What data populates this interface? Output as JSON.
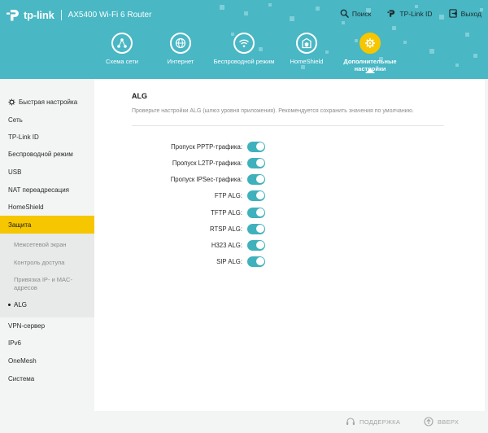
{
  "brand": {
    "logo_text": "tp-link",
    "model": "AX5400 Wi-Fi 6 Router"
  },
  "topbar": {
    "search": "Поиск",
    "tplink_id": "TP-Link ID",
    "exit": "Выход"
  },
  "nav_tabs": [
    {
      "label": "Схема сети",
      "icon": "network-map-icon"
    },
    {
      "label": "Интернет",
      "icon": "globe-icon"
    },
    {
      "label": "Беспроводной режим",
      "icon": "wifi-icon"
    },
    {
      "label": "HomeShield",
      "icon": "homeshield-icon"
    },
    {
      "label": "Дополнительные настройки",
      "icon": "advanced-gear-icon",
      "active": true
    }
  ],
  "sidebar": {
    "items": [
      {
        "label": "Быстрая настройка"
      },
      {
        "label": "Сеть"
      },
      {
        "label": "TP-Link ID"
      },
      {
        "label": "Беспроводной режим"
      },
      {
        "label": "USB"
      },
      {
        "label": "NAT переадресация"
      },
      {
        "label": "HomeShield"
      },
      {
        "label": "Защита",
        "active": true
      }
    ],
    "sub_items": [
      {
        "label": "Межсетевой экран"
      },
      {
        "label": "Контроль доступа"
      },
      {
        "label": "Привязка IP- и MAC-адресов"
      },
      {
        "label": "ALG",
        "current": true
      }
    ],
    "items_after": [
      {
        "label": "VPN-сервер"
      },
      {
        "label": "IPv6"
      },
      {
        "label": "OneMesh"
      },
      {
        "label": "Система"
      }
    ]
  },
  "main": {
    "title": "ALG",
    "description": "Проверьте настройки ALG (шлюз уровня приложения). Рекомендуется сохранить значения по умолчанию.",
    "toggles": [
      {
        "label": "Пропуск PPTP-трафика:",
        "on": true
      },
      {
        "label": "Пропуск L2TP-трафика:",
        "on": true
      },
      {
        "label": "Пропуск IPSec-трафика:",
        "on": true
      },
      {
        "label": "FTP ALG:",
        "on": true
      },
      {
        "label": "TFTP ALG:",
        "on": true
      },
      {
        "label": "RTSP ALG:",
        "on": true
      },
      {
        "label": "H323 ALG:",
        "on": true
      },
      {
        "label": "SIP ALG:",
        "on": true
      }
    ]
  },
  "footer": {
    "support": "ПОДДЕРЖКА",
    "top": "ВВЕРХ"
  },
  "colors": {
    "header_bg": "#49b7c4",
    "accent_yellow": "#f6c600",
    "toggle_on": "#3fb1bd"
  }
}
